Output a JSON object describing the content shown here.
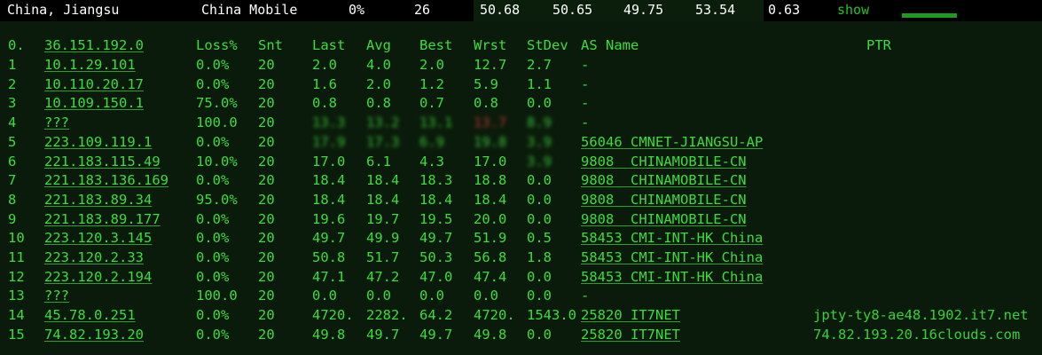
{
  "top": {
    "location": "China, Jiangsu",
    "isp": "China Mobile",
    "loss": "0%",
    "count": "26",
    "v1": "50.68",
    "v2": "50.65",
    "v3": "49.75",
    "v4": "53.54",
    "v5": "0.63",
    "show": "show"
  },
  "header": {
    "hop": "0.",
    "host": "36.151.192.0",
    "loss": "Loss%",
    "snt": "Snt",
    "last": "Last",
    "avg": "Avg",
    "best": "Best",
    "wrst": "Wrst",
    "stdev": "StDev",
    "as": "AS Name",
    "ptr": "PTR"
  },
  "hops": [
    {
      "n": "1",
      "host": "10.1.29.101",
      "loss": "0.0%",
      "snt": "20",
      "last": "2.0",
      "avg": "4.0",
      "best": "2.0",
      "wrst": "12.7",
      "stdev": "2.7",
      "as": "-",
      "ptr": ""
    },
    {
      "n": "2",
      "host": "10.110.20.17",
      "loss": "0.0%",
      "snt": "20",
      "last": "1.6",
      "avg": "2.0",
      "best": "1.2",
      "wrst": "5.9",
      "stdev": "1.1",
      "as": "-",
      "ptr": ""
    },
    {
      "n": "3",
      "host": "10.109.150.1",
      "loss": "75.0%",
      "snt": "20",
      "last": "0.8",
      "avg": "0.8",
      "best": "0.7",
      "wrst": "0.8",
      "stdev": "0.0",
      "as": "-",
      "ptr": ""
    },
    {
      "n": "4",
      "host": "???",
      "loss": "100.0",
      "snt": "20",
      "last": "13.3",
      "avg": "13.2",
      "best": "13.1",
      "wrst": "13.7",
      "stdev": "8.9",
      "as": "-",
      "ptr": ""
    },
    {
      "n": "5",
      "host": "223.109.119.1",
      "loss": "0.0%",
      "snt": "20",
      "last": "17.9",
      "avg": "17.3",
      "best": "6.9",
      "wrst": "19.8",
      "stdev": "3.9",
      "as": "56046 CMNET-JIANGSU-AP",
      "ptr": ""
    },
    {
      "n": "6",
      "host": "221.183.115.49",
      "loss": "10.0%",
      "snt": "20",
      "last": "17.0",
      "avg": "6.1",
      "best": "4.3",
      "wrst": "17.0",
      "stdev": "3.9",
      "as": "9808  CHINAMOBILE-CN",
      "ptr": ""
    },
    {
      "n": "7",
      "host": "221.183.136.169",
      "loss": "0.0%",
      "snt": "20",
      "last": "18.4",
      "avg": "18.4",
      "best": "18.3",
      "wrst": "18.8",
      "stdev": "0.0",
      "as": "9808  CHINAMOBILE-CN",
      "ptr": ""
    },
    {
      "n": "8",
      "host": "221.183.89.34",
      "loss": "95.0%",
      "snt": "20",
      "last": "18.4",
      "avg": "18.4",
      "best": "18.4",
      "wrst": "18.4",
      "stdev": "0.0",
      "as": "9808  CHINAMOBILE-CN",
      "ptr": ""
    },
    {
      "n": "9",
      "host": "221.183.89.177",
      "loss": "0.0%",
      "snt": "20",
      "last": "19.6",
      "avg": "19.7",
      "best": "19.5",
      "wrst": "20.0",
      "stdev": "0.0",
      "as": "9808  CHINAMOBILE-CN",
      "ptr": ""
    },
    {
      "n": "10",
      "host": "223.120.3.145",
      "loss": "0.0%",
      "snt": "20",
      "last": "49.7",
      "avg": "49.9",
      "best": "49.7",
      "wrst": "51.9",
      "stdev": "0.5",
      "as": "58453 CMI-INT-HK China",
      "ptr": ""
    },
    {
      "n": "11",
      "host": "223.120.2.33",
      "loss": "0.0%",
      "snt": "20",
      "last": "50.8",
      "avg": "51.7",
      "best": "50.3",
      "wrst": "56.8",
      "stdev": "1.8",
      "as": "58453 CMI-INT-HK China",
      "ptr": ""
    },
    {
      "n": "12",
      "host": "223.120.2.194",
      "loss": "0.0%",
      "snt": "20",
      "last": "47.1",
      "avg": "47.2",
      "best": "47.0",
      "wrst": "47.4",
      "stdev": "0.0",
      "as": "58453 CMI-INT-HK China",
      "ptr": ""
    },
    {
      "n": "13",
      "host": "???",
      "loss": "100.0",
      "snt": "20",
      "last": "0.0",
      "avg": "0.0",
      "best": "0.0",
      "wrst": "0.0",
      "stdev": "0.0",
      "as": "-",
      "ptr": ""
    },
    {
      "n": "14",
      "host": "45.78.0.251",
      "loss": "0.0%",
      "snt": "20",
      "last": "4720.",
      "avg": "2282.",
      "best": "64.2",
      "wrst": "4720.",
      "stdev": "1543.0",
      "as": "25820 IT7NET",
      "ptr": "jpty-ty8-ae48.1902.it7.net"
    },
    {
      "n": "15",
      "host": "74.82.193.20",
      "loss": "0.0%",
      "snt": "20",
      "last": "49.8",
      "avg": "49.7",
      "best": "49.7",
      "wrst": "49.8",
      "stdev": "0.0",
      "as": "25820 IT7NET",
      "ptr": "74.82.193.20.16clouds.com"
    }
  ]
}
